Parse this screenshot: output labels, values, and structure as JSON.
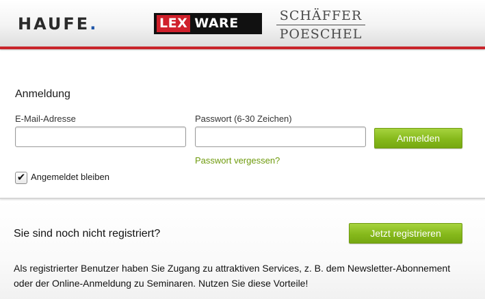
{
  "header": {
    "haufe_logo": "HAUFE",
    "haufe_dot": ".",
    "lexware_lex": "LEX",
    "lexware_ware": "WARE",
    "sp_line1": "SCHÄFFER",
    "sp_line2": "POESCHEL",
    "accent_color": "#c9242b"
  },
  "login": {
    "title": "Anmeldung",
    "email_label": "E-Mail-Adresse",
    "email_value": "",
    "password_label": "Passwort (6-30 Zeichen)",
    "password_value": "",
    "submit_label": "Anmelden",
    "forgot_label": "Passwort vergessen?",
    "remember_label": "Angemeldet bleiben",
    "remember_checked": true,
    "check_glyph": "✔"
  },
  "register": {
    "question": "Sie sind noch nicht registriert?",
    "button_label": "Jetzt registrieren",
    "description": "Als registrierter Benutzer haben Sie Zugang zu attraktiven Services, z. B. dem Newsletter-Abonnement oder der Online-Anmeldung zu Seminaren. Nutzen Sie diese Vorteile!"
  },
  "colors": {
    "button_green": "#86b91b",
    "link_green": "#6e9a0c"
  }
}
